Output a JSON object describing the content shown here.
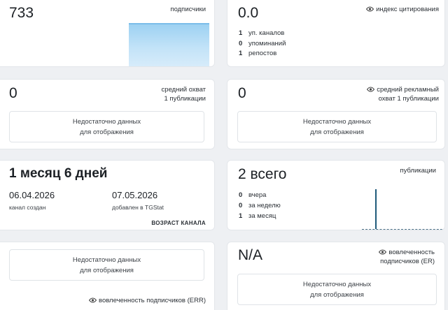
{
  "subscribers": {
    "value": "733",
    "label": "подписчики"
  },
  "citation": {
    "value": "0.0",
    "label": "индекс цитирования",
    "rows": [
      {
        "n": "1",
        "text": "уп. каналов"
      },
      {
        "n": "0",
        "text": "упоминаний"
      },
      {
        "n": "1",
        "text": "репостов"
      }
    ]
  },
  "avg_reach": {
    "value": "0",
    "label_line1": "средний охват",
    "label_line2": "1 публикации",
    "nodata_line1": "Недостаточно данных",
    "nodata_line2": "для отображения"
  },
  "avg_ad_reach": {
    "value": "0",
    "label_line1": "средний рекламный",
    "label_line2": "охват 1 публикации",
    "nodata_line1": "Недостаточно данных",
    "nodata_line2": "для отображения"
  },
  "channel_age": {
    "value": "1 месяц 6 дней",
    "created_date": "06.04.2026",
    "created_label": "канал создан",
    "added_date": "07.05.2026",
    "added_label": "добавлен в TGStat",
    "footer": "ВОЗРАСТ КАНАЛА"
  },
  "publications": {
    "value": "2 всего",
    "label": "публикации",
    "rows": [
      {
        "n": "0",
        "text": "вчера"
      },
      {
        "n": "0",
        "text": "за неделю"
      },
      {
        "n": "1",
        "text": "за месяц"
      }
    ]
  },
  "err_left": {
    "nodata_line1": "Недостаточно данных",
    "nodata_line2": "для отображения",
    "footer": "вовлеченность подписчиков (ERR)"
  },
  "err_right": {
    "value": "N/A",
    "label_line1": "вовлеченность",
    "label_line2": "подписчиков (ER)",
    "nodata_line1": "Недостаточно данных",
    "nodata_line2": "для отображения"
  },
  "colors": {
    "accent_bar": "#1f5a7a",
    "area_fill": "#9dd1f2",
    "card_bg": "#ffffff",
    "page_bg": "#eef0f3"
  },
  "icons": {
    "eye": "eye-icon"
  }
}
